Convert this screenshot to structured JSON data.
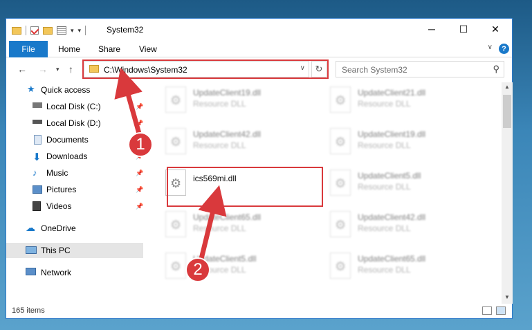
{
  "window": {
    "title": "System32",
    "minimize_label": "─",
    "maximize_label": "☐",
    "close_label": "✕"
  },
  "ribbon": {
    "tabs": [
      "File",
      "Home",
      "Share",
      "View"
    ],
    "help_label": "?"
  },
  "nav": {
    "address": "C:\\Windows\\System32",
    "search_placeholder": "Search System32"
  },
  "sidebar": {
    "items": [
      {
        "label": "Quick access",
        "icon": "star-icon"
      },
      {
        "label": "Local Disk (C:)",
        "icon": "drive-icon"
      },
      {
        "label": "Local Disk (D:)",
        "icon": "drive-icon"
      },
      {
        "label": "Documents",
        "icon": "documents-icon"
      },
      {
        "label": "Downloads",
        "icon": "downloads-icon"
      },
      {
        "label": "Music",
        "icon": "music-icon"
      },
      {
        "label": "Pictures",
        "icon": "pictures-icon"
      },
      {
        "label": "Videos",
        "icon": "videos-icon"
      },
      {
        "label": "OneDrive",
        "icon": "onedrive-icon"
      },
      {
        "label": "This PC",
        "icon": "computer-icon"
      },
      {
        "label": "Network",
        "icon": "network-icon"
      }
    ]
  },
  "files": [
    {
      "name": "UpdateClient19.dll",
      "type": "Resource DLL"
    },
    {
      "name": "UpdateClient21.dll",
      "type": "Resource DLL"
    },
    {
      "name": "UpdateClient42.dll",
      "type": "Resource DLL"
    },
    {
      "name": "UpdateClient19.dll",
      "type": "Resource DLL"
    },
    {
      "name": "ics569mi.dll",
      "type": ""
    },
    {
      "name": "UpdateClient5.dll",
      "type": "Resource DLL"
    },
    {
      "name": "UpdateClient65.dll",
      "type": "Resource DLL"
    },
    {
      "name": "UpdateClient42.dll",
      "type": "Resource DLL"
    },
    {
      "name": "UpdateClient5.dll",
      "type": "Resource DLL"
    },
    {
      "name": "UpdateClient65.dll",
      "type": "Resource DLL"
    }
  ],
  "status": {
    "item_count": "165 items"
  },
  "annotations": {
    "step1": "1",
    "step2": "2"
  },
  "colors": {
    "accent": "#1979ca",
    "annotation_red": "#d9393c"
  }
}
